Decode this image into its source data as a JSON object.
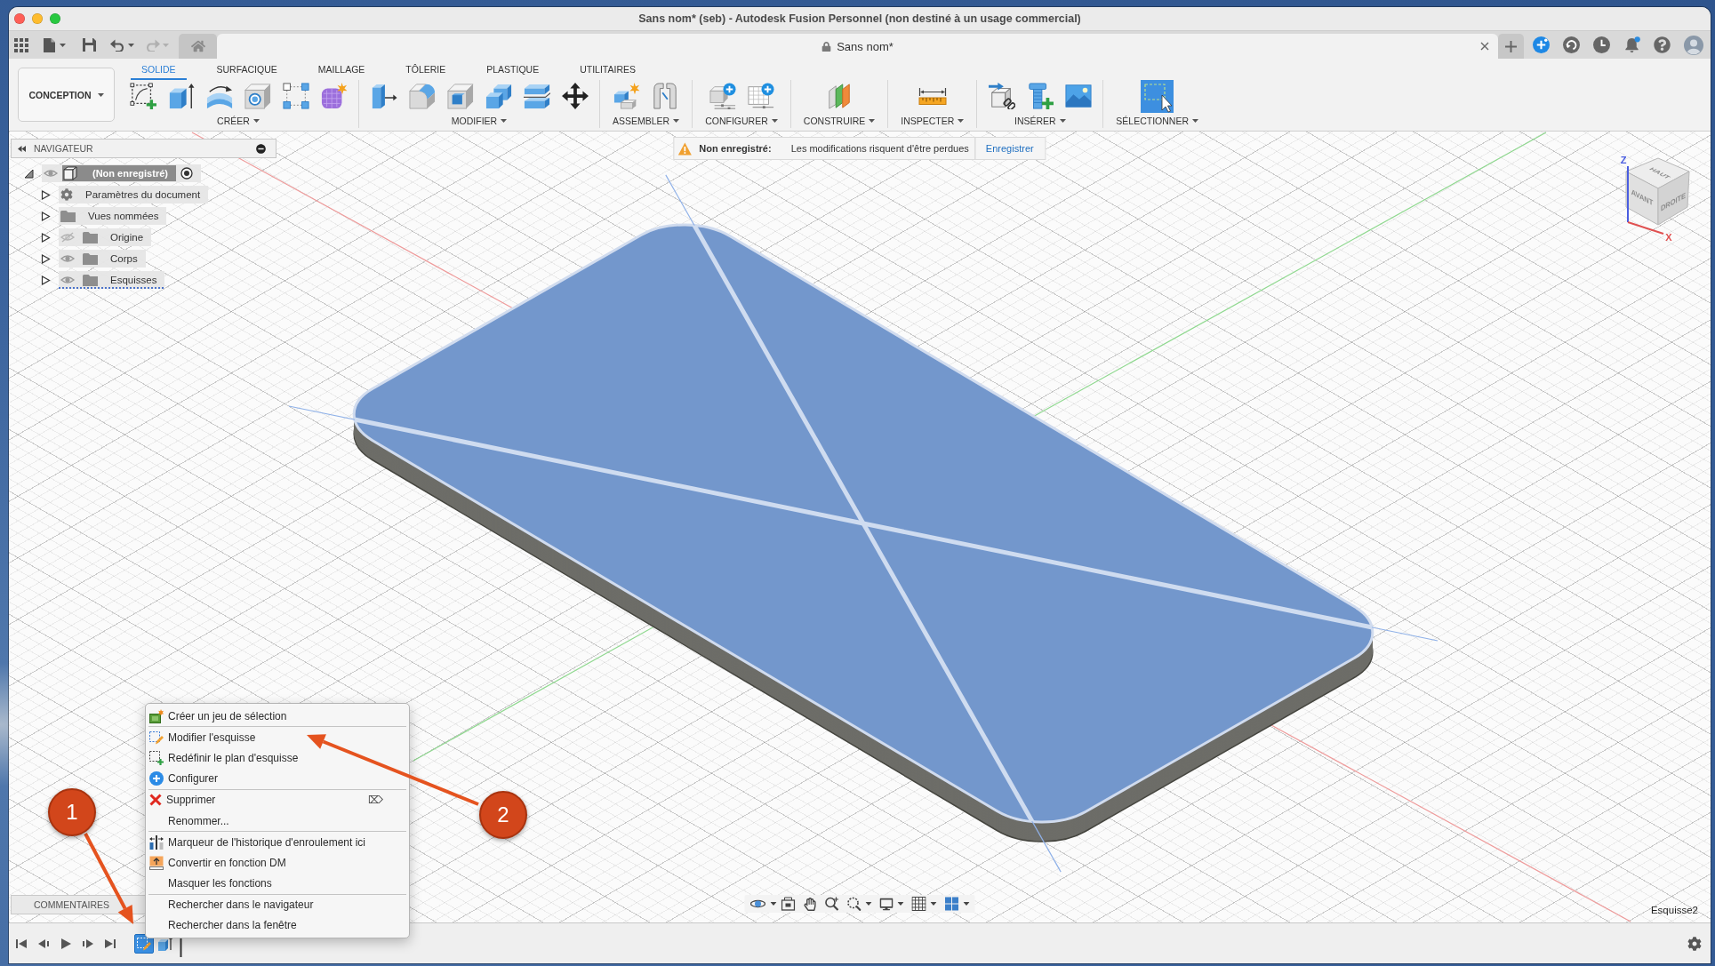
{
  "window": {
    "title": "Sans nom* (seb) - Autodesk Fusion Personnel (non destiné à un usage commercial)"
  },
  "quick_access": {
    "undo": {
      "disabled": false
    },
    "redo": {
      "disabled": true
    }
  },
  "document_tab": {
    "title": "Sans nom*"
  },
  "toolbar": {
    "workspace": "CONCEPTION",
    "tabs": [
      {
        "label": "SOLIDE",
        "selected": true
      },
      {
        "label": "SURFACIQUE",
        "selected": false
      },
      {
        "label": "MAILLAGE",
        "selected": false
      },
      {
        "label": "TÔLERIE",
        "selected": false
      },
      {
        "label": "PLASTIQUE",
        "selected": false
      },
      {
        "label": "UTILITAIRES",
        "selected": false
      }
    ],
    "groups": [
      {
        "label": "CRÉER"
      },
      {
        "label": "MODIFIER"
      },
      {
        "label": "ASSEMBLER"
      },
      {
        "label": "CONFIGURER"
      },
      {
        "label": "CONSTRUIRE"
      },
      {
        "label": "INSPECTER"
      },
      {
        "label": "INSÉRER"
      },
      {
        "label": "SÉLECTIONNER"
      }
    ]
  },
  "notification": {
    "title": "Non enregistré:",
    "message": "Les modifications risquent d'être perdues",
    "action": "Enregistrer"
  },
  "navigator": {
    "title": "NAVIGATEUR",
    "tree": [
      {
        "label": "(Non enregistré)",
        "kind": "component",
        "visible": true,
        "expanded": true,
        "active": true,
        "underlined": false,
        "children": [
          {
            "label": "Paramètres du document",
            "kind": "settings",
            "expanded": false,
            "underlined": false
          },
          {
            "label": "Vues nommées",
            "kind": "folder",
            "expanded": false,
            "underlined": false
          },
          {
            "label": "Origine",
            "kind": "folder",
            "visible": false,
            "expanded": false,
            "underlined": false
          },
          {
            "label": "Corps",
            "kind": "folder",
            "visible": true,
            "expanded": false,
            "underlined": false
          },
          {
            "label": "Esquisses",
            "kind": "folder",
            "visible": true,
            "expanded": false,
            "underlined": true
          }
        ]
      }
    ]
  },
  "viewcube": {
    "faces": [
      "HAUT",
      "AVANT",
      "DROITE"
    ],
    "axes": [
      "Z",
      "X"
    ]
  },
  "comments": {
    "title": "COMMENTAIRES"
  },
  "active_sketch": {
    "name": "Esquisse2"
  },
  "timeline": {
    "features": [
      {
        "kind": "sketch",
        "selected": true
      },
      {
        "kind": "extrude",
        "selected": false
      }
    ]
  },
  "context_menu": {
    "groups": [
      [
        {
          "label": "Créer un jeu de sélection"
        }
      ],
      [
        {
          "label": "Modifier l'esquisse"
        },
        {
          "label": "Redéfinir le plan d'esquisse"
        },
        {
          "label": "Configurer"
        }
      ],
      [
        {
          "label": "Supprimer",
          "shortcut": "⌦"
        },
        {
          "label": "Renommer..."
        }
      ],
      [
        {
          "label": "Marqueur de l'historique d'enroulement ici"
        },
        {
          "label": "Convertir en fonction DM"
        },
        {
          "label": "Masquer les fonctions"
        }
      ],
      [
        {
          "label": "Rechercher dans le navigateur"
        },
        {
          "label": "Rechercher dans la fenêtre"
        }
      ]
    ]
  },
  "callouts": [
    {
      "label": "1"
    },
    {
      "label": "2"
    }
  ]
}
